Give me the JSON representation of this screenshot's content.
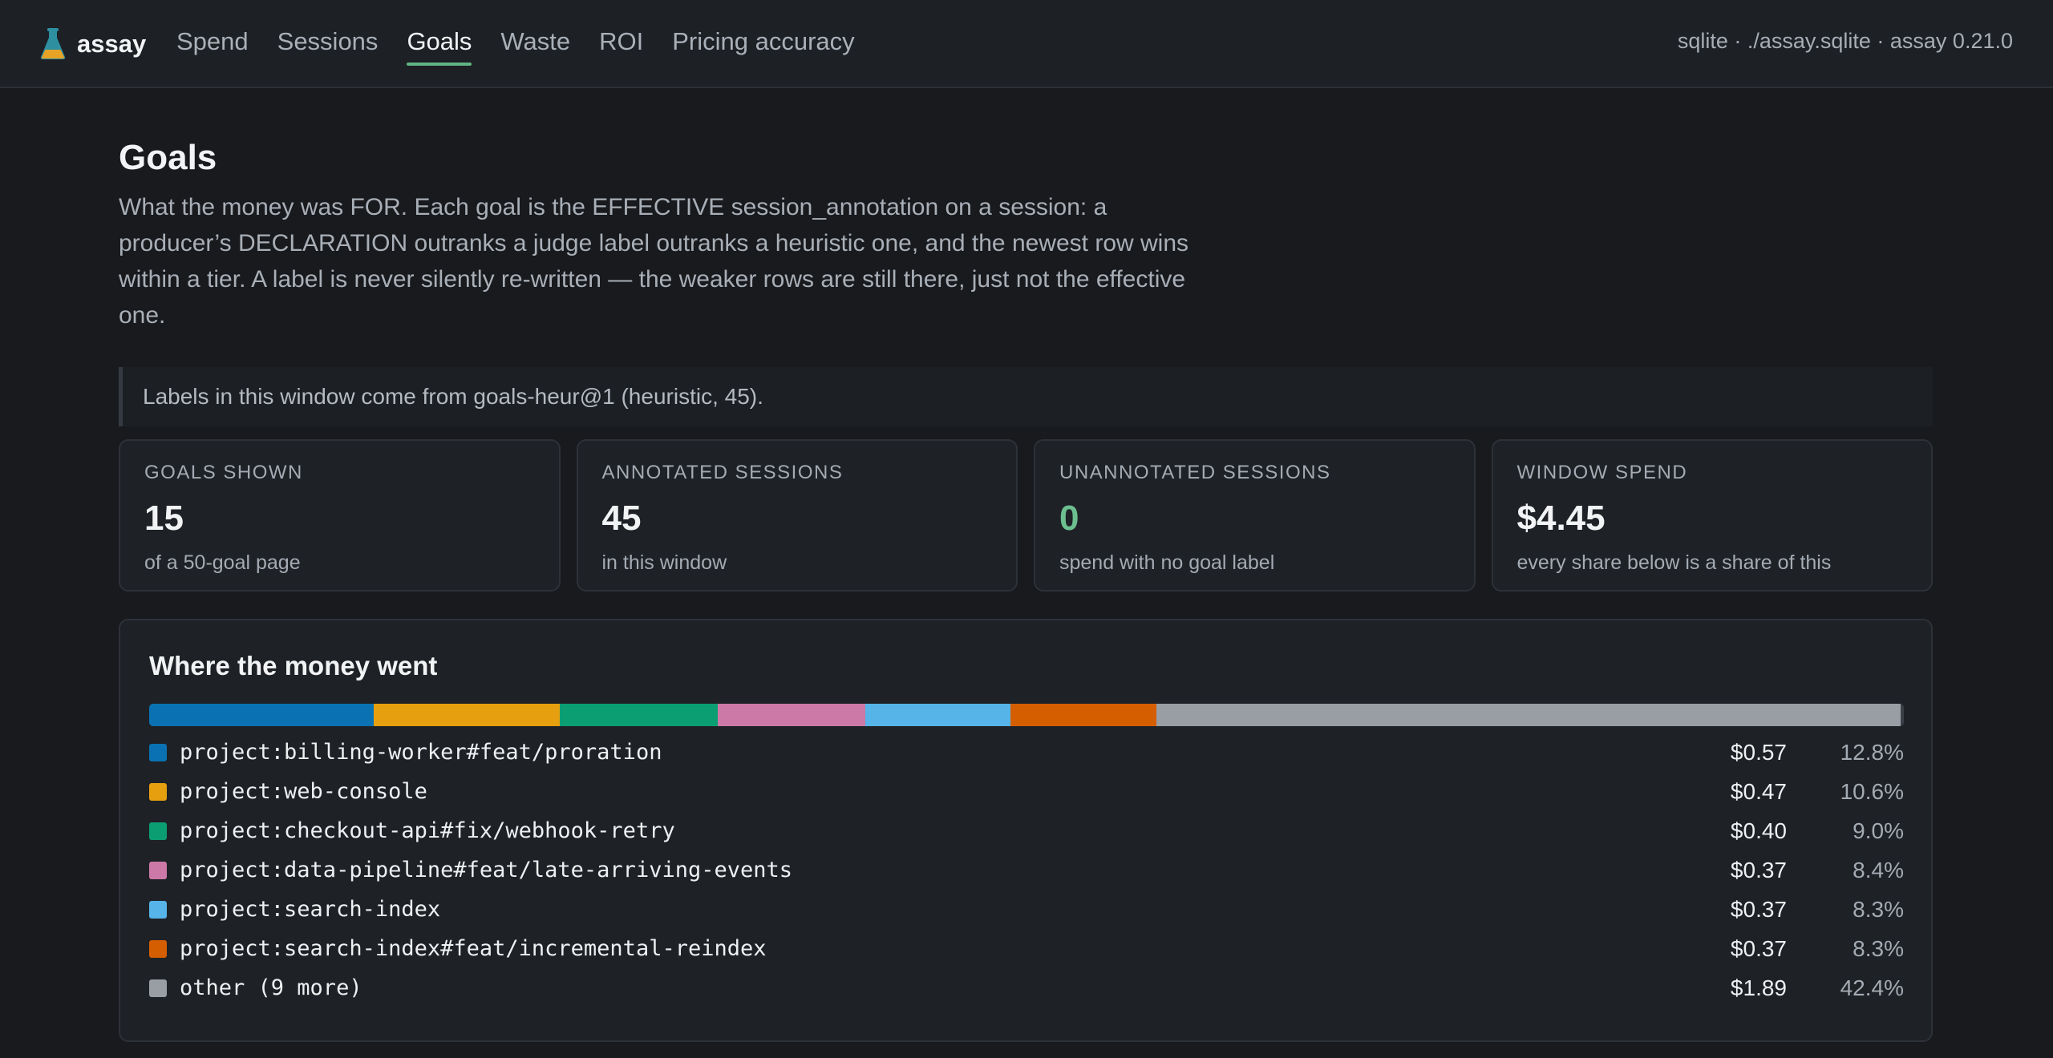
{
  "nav": {
    "brand": "assay",
    "links": [
      {
        "label": "Spend",
        "active": false
      },
      {
        "label": "Sessions",
        "active": false
      },
      {
        "label": "Goals",
        "active": true
      },
      {
        "label": "Waste",
        "active": false
      },
      {
        "label": "ROI",
        "active": false
      },
      {
        "label": "Pricing accuracy",
        "active": false
      }
    ],
    "meta": "sqlite · ./assay.sqlite · assay 0.21.0",
    "logo_icon": "flask-icon"
  },
  "page": {
    "title": "Goals",
    "description": "What the money was FOR. Each goal is the EFFECTIVE session_annotation on a session: a producer’s DECLARATION outranks a judge label outranks a heuristic one, and the newest row wins within a tier. A label is never silently re-written — the weaker rows are still there, just not the effective one.",
    "note": "Labels in this window come from goals-heur@1 (heuristic, 45)."
  },
  "stats": [
    {
      "label": "GOALS SHOWN",
      "value": "15",
      "sub": "of a 50-goal page"
    },
    {
      "label": "ANNOTATED SESSIONS",
      "value": "45",
      "sub": "in this window"
    },
    {
      "label": "UNANNOTATED SESSIONS",
      "value": "0",
      "sub": "spend with no goal label",
      "accent": "#6dbf8f"
    },
    {
      "label": "WINDOW SPEND",
      "value": "$4.45",
      "sub": "every share below is a share of this"
    }
  ],
  "breakdown": {
    "title": "Where the money went",
    "items": [
      {
        "label": "project:billing-worker#feat/proration",
        "amount": "$0.57",
        "pct": "12.8%",
        "share": 12.8,
        "color": "#0a72b2"
      },
      {
        "label": "project:web-console",
        "amount": "$0.47",
        "pct": "10.6%",
        "share": 10.6,
        "color": "#e69f0e"
      },
      {
        "label": "project:checkout-api#fix/webhook-retry",
        "amount": "$0.40",
        "pct": "9.0%",
        "share": 9.0,
        "color": "#0b9e73"
      },
      {
        "label": "project:data-pipeline#feat/late-arriving-events",
        "amount": "$0.37",
        "pct": "8.4%",
        "share": 8.4,
        "color": "#cc79a7"
      },
      {
        "label": "project:search-index",
        "amount": "$0.37",
        "pct": "8.3%",
        "share": 8.3,
        "color": "#56b4e9"
      },
      {
        "label": "project:search-index#feat/incremental-reindex",
        "amount": "$0.37",
        "pct": "8.3%",
        "share": 8.3,
        "color": "#d55e00"
      },
      {
        "label": "other (9 more)",
        "amount": "$1.89",
        "pct": "42.4%",
        "share": 42.4,
        "color": "#999da4"
      }
    ]
  }
}
